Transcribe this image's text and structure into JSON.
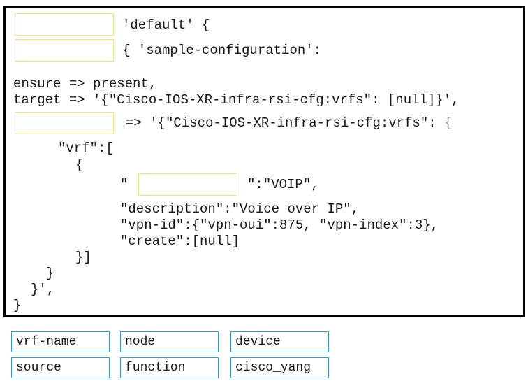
{
  "code": {
    "line1_after_blank": "'default' {",
    "line2_after_blank": "{ 'sample-configuration':",
    "ensure_line": "ensure => present,",
    "target_line": "target => '{\"Cisco-IOS-XR-infra-rsi-cfg:vrfs\": [null]}',",
    "line_after_blank3": "=> '{\"Cisco-IOS-XR-infra-rsi-cfg:vrfs\": ",
    "line_after_blank3_brace": "{",
    "vrf_line": "\"vrf\":[",
    "open_brace": "{",
    "quote_before_blank": "\"",
    "after_blank4": "\":\"VOIP\",",
    "description_line": "\"description\":\"Voice over IP\",",
    "vpn_id_line": "\"vpn-id\":{\"vpn-oui\":875, \"vpn-index\":3},",
    "create_line": "\"create\":[null]",
    "close_array": "}]",
    "close_brace1": "}",
    "close_brace2": "}',",
    "close_brace3": "}"
  },
  "drop_targets": [
    {
      "label": "",
      "position": "before 'default'"
    },
    {
      "label": "",
      "position": "before sample-configuration"
    },
    {
      "label": "",
      "position": "before => '{...vrfs'"
    },
    {
      "label": "",
      "position": "vrf key name"
    }
  ],
  "options": [
    {
      "label": "vrf-name"
    },
    {
      "label": "node"
    },
    {
      "label": "device"
    },
    {
      "label": "source"
    },
    {
      "label": "function"
    },
    {
      "label": "cisco_yang"
    }
  ],
  "colors": {
    "frame_border": "#000000",
    "drop_border": "#f0e28a",
    "option_border": "#3d96bf"
  }
}
